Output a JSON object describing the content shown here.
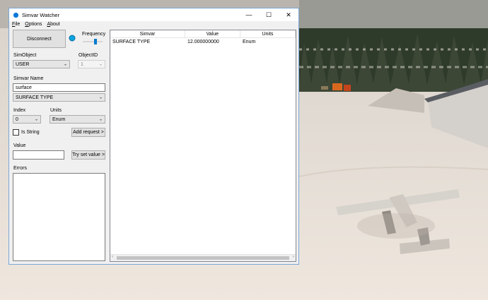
{
  "window": {
    "title": "Simvar Watcher",
    "controls": {
      "minimize": "—",
      "maximize": "☐",
      "close": "✕"
    }
  },
  "menu": [
    "File",
    "Options",
    "About"
  ],
  "connect_button": "Disconnect",
  "frequency_label": "Frequency",
  "simobject": {
    "label": "SimObject",
    "value": "USER"
  },
  "objectid": {
    "label": "ObjectID",
    "value": "1"
  },
  "simvar_name": {
    "label": "Simvar Name",
    "search_value": "surface",
    "selected": "SURFACE TYPE"
  },
  "index": {
    "label": "Index",
    "value": "0"
  },
  "units": {
    "label": "Units",
    "value": "Enum"
  },
  "is_string": {
    "label": "Is String",
    "checked": false
  },
  "add_request_button": "Add request >",
  "value_field": {
    "label": "Value",
    "value": ""
  },
  "try_set_value_button": "Try set value >",
  "errors": {
    "label": "Errors",
    "text": ""
  },
  "table": {
    "columns": [
      "Simvar",
      "Value",
      "Units"
    ],
    "rows": [
      {
        "simvar": "SURFACE TYPE",
        "value": "12.000000000",
        "units": "Enum"
      }
    ]
  },
  "colors": {
    "accent": "#0078d7",
    "window_border": "#7aa7d6",
    "background_snow": "#e7ddd2"
  }
}
